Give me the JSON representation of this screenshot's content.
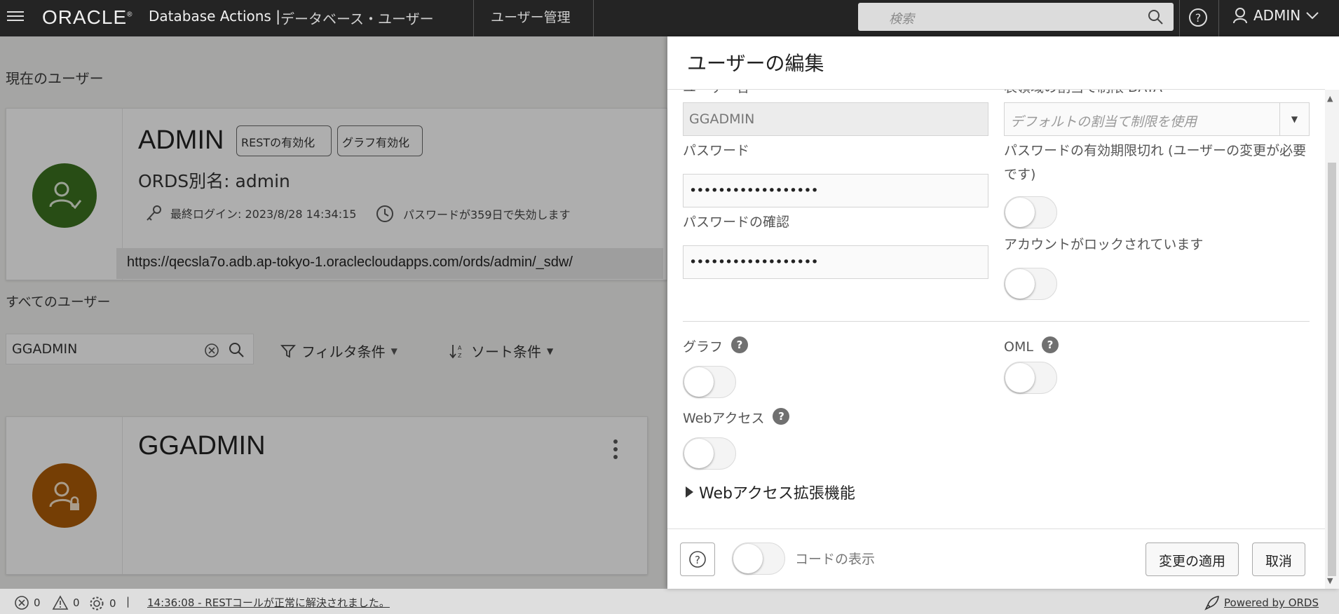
{
  "topbar": {
    "logo": "ORACLE",
    "logo_reg": "®",
    "app_name": "Database Actions |",
    "page_name": "データベース・ユーザー",
    "nav_item": "ユーザー管理",
    "search_placeholder": "検索",
    "user_name": "ADMIN"
  },
  "current_user": {
    "section_title": "現在のユーザー",
    "name": "ADMIN",
    "rest_button": "RESTの有効化",
    "graph_button": "グラフ有効化",
    "ords_alias": "ORDS別名: admin",
    "last_login": "最終ログイン: 2023/8/28 14:34:15",
    "password_expiry": "パスワードが359日で失効します",
    "url": "https://qecsla7o.adb.ap-tokyo-1.oraclecloudapps.com/ords/admin/_sdw/",
    "avatar_color": "#3a6f1f"
  },
  "all_users": {
    "section_title": "すべてのユーザー",
    "filter_value": "GGADMIN",
    "filter_button": "フィルタ条件",
    "sort_button": "ソート条件",
    "users": [
      {
        "name": "GGADMIN",
        "avatar_color": "#a85a08"
      }
    ]
  },
  "drawer": {
    "title": "ユーザーの編集",
    "username_label": "ユーザー名",
    "username_value": "GGADMIN",
    "quota_label": "表領域の割当て制限 DATA",
    "quota_placeholder": "デフォルトの割当て制限を使用",
    "password_label": "パスワード",
    "password_value": "••••••••••••••••••",
    "password_confirm_label": "パスワードの確認",
    "password_confirm_value": "••••••••••••••••••",
    "password_expired_label": "パスワードの有効期限切れ (ユーザーの変更が必要です)",
    "account_locked_label": "アカウントがロックされています",
    "graph_label": "グラフ",
    "oml_label": "OML",
    "web_access_label": "Webアクセス",
    "web_access_ext_label": "Webアクセス拡張機能",
    "show_code_label": "コードの表示",
    "apply_button": "変更の適用",
    "cancel_button": "取消"
  },
  "statusbar": {
    "errors": "0",
    "warnings": "0",
    "processes": "0",
    "message": "14:36:08 - RESTコールが正常に解決されました。",
    "powered_by": "Powered by ORDS"
  }
}
